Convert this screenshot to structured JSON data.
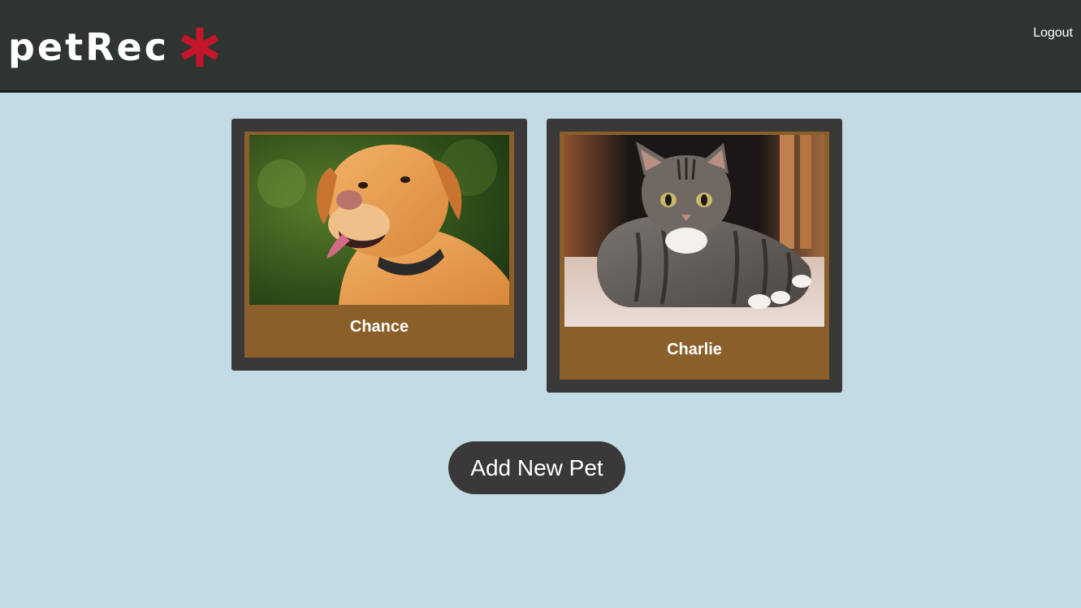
{
  "header": {
    "brand": "petRec",
    "logout_label": "Logout"
  },
  "pets": [
    {
      "name": "Chance"
    },
    {
      "name": "Charlie"
    }
  ],
  "actions": {
    "add_pet_label": "Add New Pet"
  },
  "colors": {
    "page_background": "#c3dbe4",
    "header_background": "#2e342f",
    "card_frame": "#3a3838",
    "card_inner": "#8a5f2a",
    "logo_asterisk": "#c4152a"
  },
  "icons": {
    "logo_mark": "asterisk-icon"
  }
}
